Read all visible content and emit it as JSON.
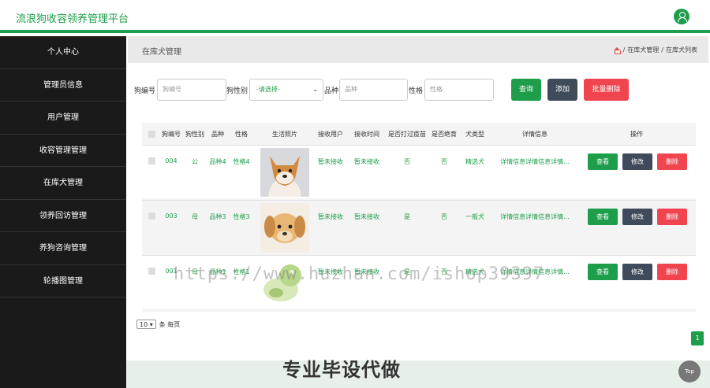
{
  "app": {
    "title": "流浪狗收容领养管理平台"
  },
  "sidebar": {
    "items": [
      {
        "label": "个人中心"
      },
      {
        "label": "管理员信息"
      },
      {
        "label": "用户管理"
      },
      {
        "label": "收容管理管理"
      },
      {
        "label": "在库犬管理"
      },
      {
        "label": "领养回访管理"
      },
      {
        "label": "养狗咨询管理"
      },
      {
        "label": "轮播图管理"
      }
    ]
  },
  "breadcrumb": {
    "title": "在库犬管理",
    "path": [
      "在库犬管理",
      "在库犬列表"
    ],
    "sep": "/"
  },
  "search": {
    "fields": [
      {
        "label": "狗编号",
        "placeholder": "狗编号"
      },
      {
        "label": "狗性别",
        "select_value": "-请选择-"
      },
      {
        "label": "品种",
        "placeholder": "品种"
      },
      {
        "label": "性格",
        "placeholder": "性格"
      }
    ],
    "query_label": "查询",
    "add_label": "添加",
    "batch_delete_label": "批量删除"
  },
  "table": {
    "headers": [
      "狗编号",
      "狗性别",
      "品种",
      "性格",
      "生活照片",
      "接收用户",
      "接收时间",
      "是否打过疫苗",
      "是否绝育",
      "犬类型",
      "详情信息",
      "操作"
    ],
    "rows": [
      {
        "id": "004",
        "sex": "公",
        "breed": "品种4",
        "temper": "性格4",
        "user": "暂未接收",
        "time": "暂未接收",
        "vaccine": "否",
        "neutered": "否",
        "type": "精选犬",
        "detail": "详情信息详情信息详情..."
      },
      {
        "id": "003",
        "sex": "母",
        "breed": "品种3",
        "temper": "性格3",
        "user": "暂未接收",
        "time": "暂未接收",
        "vaccine": "是",
        "neutered": "否",
        "type": "一般犬",
        "detail": "详情信息详情信息详情..."
      },
      {
        "id": "001",
        "sex": "母",
        "breed": "品种1",
        "temper": "性格1",
        "user": "暂未接收",
        "time": "暂未接收",
        "vaccine": "是",
        "neutered": "否",
        "type": "精选犬",
        "detail": "详情信息详情信息详情..."
      }
    ],
    "actions": {
      "view": "查看",
      "edit": "修改",
      "delete": "删除"
    }
  },
  "pagination": {
    "page_size": "10",
    "per_page_label": "条 每页",
    "current_page": "1"
  },
  "overlay": {
    "watermark": "https://www.huzhan.com/ishop39397",
    "banner": "专业毕设代做",
    "top_label": "Top"
  },
  "colors": {
    "primary": "#1e9e4a",
    "dark": "#1a1a1a",
    "btn_dark": "#3f4a5a",
    "danger": "#f0454f"
  }
}
